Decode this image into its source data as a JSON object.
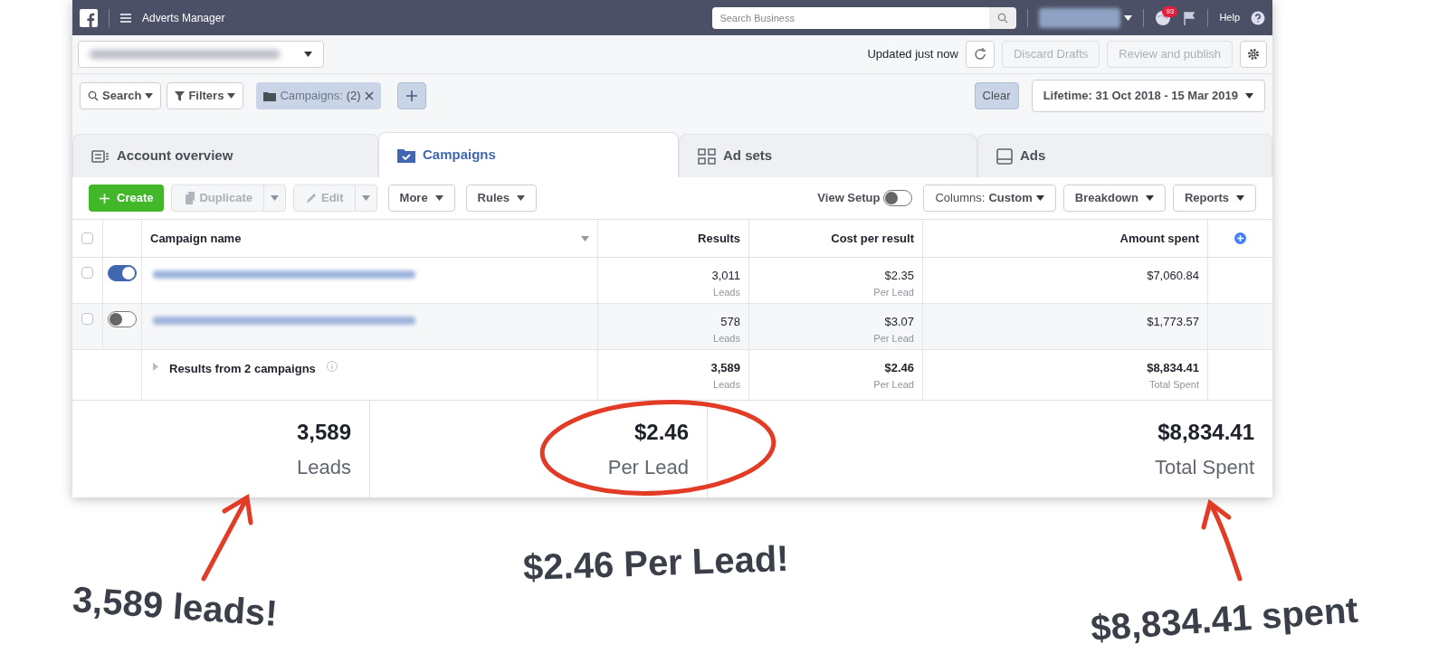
{
  "top_bar": {
    "app_title": "Adverts Manager",
    "search_placeholder": "Search Business",
    "notification_count": "93",
    "help_label": "Help"
  },
  "account_bar": {
    "updated_text": "Updated just now",
    "buttons": [
      {
        "label": "Discard Drafts",
        "disabled": true
      },
      {
        "label": "Review and publish",
        "disabled": true
      }
    ]
  },
  "filter_bar": {
    "search": "Search",
    "filters": "Filters",
    "campaign_filter": "Campaigns:",
    "campaign_count": "(2)",
    "clear": "Clear",
    "date_range": "Lifetime: 31 Oct 2018 - 15 Mar 2019"
  },
  "tabs": [
    {
      "label": "Account overview",
      "selected": false
    },
    {
      "label": "Campaigns",
      "selected": true
    },
    {
      "label": "Ad sets",
      "selected": false
    },
    {
      "label": "Ads",
      "selected": false
    }
  ],
  "toolbar": {
    "buttons": [
      {
        "kind": "primary",
        "label": "Create",
        "disabled": false
      },
      {
        "kind": "split",
        "label": "Duplicate",
        "disabled": true
      },
      {
        "kind": "split",
        "label": "Edit",
        "disabled": true
      },
      {
        "kind": "dropdown",
        "label": "More",
        "disabled": false
      },
      {
        "kind": "dropdown",
        "label": "Rules",
        "disabled": false
      }
    ],
    "view_setup": {
      "label": "View Setup",
      "on": false
    },
    "columns_label": "Columns:",
    "columns_value": "Custom",
    "breakdown": "Breakdown",
    "reports": "Reports"
  },
  "table": {
    "select_all_checked": false,
    "columns": [
      "Campaign name",
      "Results",
      "Cost per result",
      "Amount spent"
    ],
    "rows": [
      {
        "checked": false,
        "on": true,
        "results": "3,011",
        "results_unit": "Leads",
        "cost": "$2.35",
        "cost_unit": "Per Lead",
        "spent": "$7,060.84"
      },
      {
        "checked": false,
        "on": false,
        "results": "578",
        "results_unit": "Leads",
        "cost": "$3.07",
        "cost_unit": "Per Lead",
        "spent": "$1,773.57"
      }
    ],
    "summary": {
      "label": "Results from 2 campaigns",
      "results": "3,589",
      "results_unit": "Leads",
      "cost": "$2.46",
      "cost_unit": "Per Lead",
      "spent": "$8,834.41",
      "spent_unit": "Total Spent"
    }
  },
  "totals": [
    {
      "value": "3,589",
      "label": "Leads"
    },
    {
      "value": "$2.46",
      "label": "Per Lead"
    },
    {
      "value": "$8,834.41",
      "label": "Total Spent"
    }
  ],
  "annotations": [
    "3,589 leads!",
    "$2.46 Per Lead!",
    "$8,834.41 spent"
  ]
}
